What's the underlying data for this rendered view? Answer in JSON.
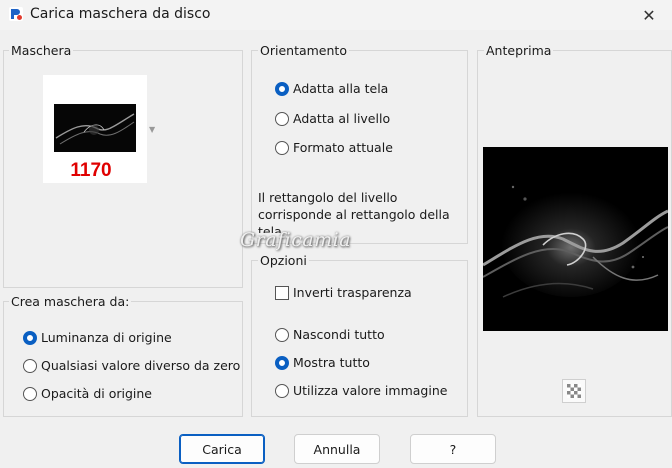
{
  "window": {
    "title": "Carica maschera da disco",
    "close_glyph": "✕",
    "app_icon": "paint-shop-icon"
  },
  "maschera": {
    "label": "Maschera",
    "mask_number": "1170"
  },
  "orientamento": {
    "label": "Orientamento",
    "options": [
      {
        "label": "Adatta alla tela",
        "checked": true
      },
      {
        "label": "Adatta al livello",
        "checked": false
      },
      {
        "label": "Formato attuale",
        "checked": false
      }
    ],
    "info_text": "Il rettangolo del livello corrisponde al rettangolo della tela"
  },
  "anteprima": {
    "label": "Anteprima"
  },
  "crea": {
    "label": "Crea maschera da:",
    "options": [
      {
        "label": "Luminanza di origine",
        "checked": true
      },
      {
        "label": "Qualsiasi valore diverso da zero",
        "checked": false
      },
      {
        "label": "Opacità di origine",
        "checked": false
      }
    ]
  },
  "opzioni": {
    "label": "Opzioni",
    "invert_label": "Inverti trasparenza",
    "invert_checked": false,
    "options": [
      {
        "label": "Nascondi tutto",
        "checked": false
      },
      {
        "label": "Mostra tutto",
        "checked": true
      },
      {
        "label": "Utilizza valore immagine",
        "checked": false
      }
    ]
  },
  "buttons": {
    "load": "Carica",
    "cancel": "Annulla",
    "help": "?"
  },
  "watermark": "Graficamia",
  "colors": {
    "accent": "#0a5fc2",
    "mask_number": "#e00000"
  }
}
